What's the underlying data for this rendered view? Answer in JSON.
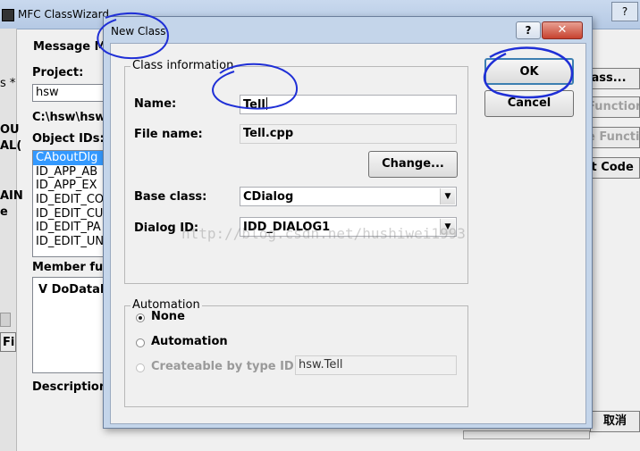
{
  "background_window": {
    "title": "MFC ClassWizard",
    "help_glyph": "?",
    "tab_label": "Message M",
    "project_label": "Project:",
    "project_value": "hsw",
    "path_value": "C:\\hsw\\hsw.",
    "object_ids_label": "Object IDs:",
    "object_ids": [
      "CAboutDlg",
      "ID_APP_AB",
      "ID_APP_EX",
      "ID_EDIT_CO",
      "ID_EDIT_CU",
      "ID_EDIT_PA",
      "ID_EDIT_UN"
    ],
    "member_functions_label": "Member func",
    "member_entry": "V   DoDataE",
    "description_label": "Description:",
    "left_edge_fragments": [
      "s *",
      "OU",
      "AL(",
      "AIN",
      "e",
      "Fi"
    ],
    "right_buttons": {
      "add_class": "lass...",
      "add_function": "Function",
      "delete_function": "e Function",
      "edit_code": "it Code",
      "cancel_cn": "取消"
    }
  },
  "dialog": {
    "title": "New Class",
    "help_glyph": "?",
    "close_glyph": "✕",
    "class_info_group": "Class information",
    "name_label": "Name:",
    "name_value": "Tell",
    "file_name_label": "File name:",
    "file_name_value": "Tell.cpp",
    "change_button": "Change...",
    "base_class_label": "Base class:",
    "base_class_value": "CDialog",
    "dialog_id_label": "Dialog ID:",
    "dialog_id_value": "IDD_DIALOG1",
    "ok_button": "OK",
    "cancel_button": "Cancel",
    "automation_group": "Automation",
    "radio_none": "None",
    "radio_automation": "Automation",
    "radio_createable": "Createable by type ID:",
    "type_id_value": "hsw.Tell",
    "dropdown_glyph": "▼"
  },
  "watermark": "http://blog.csdn.net/hushiwei1993",
  "colors": {
    "annotation_blue": "#1f2fd6",
    "selection_blue": "#3399ff",
    "dialog_frame": "#c4d5ea"
  }
}
